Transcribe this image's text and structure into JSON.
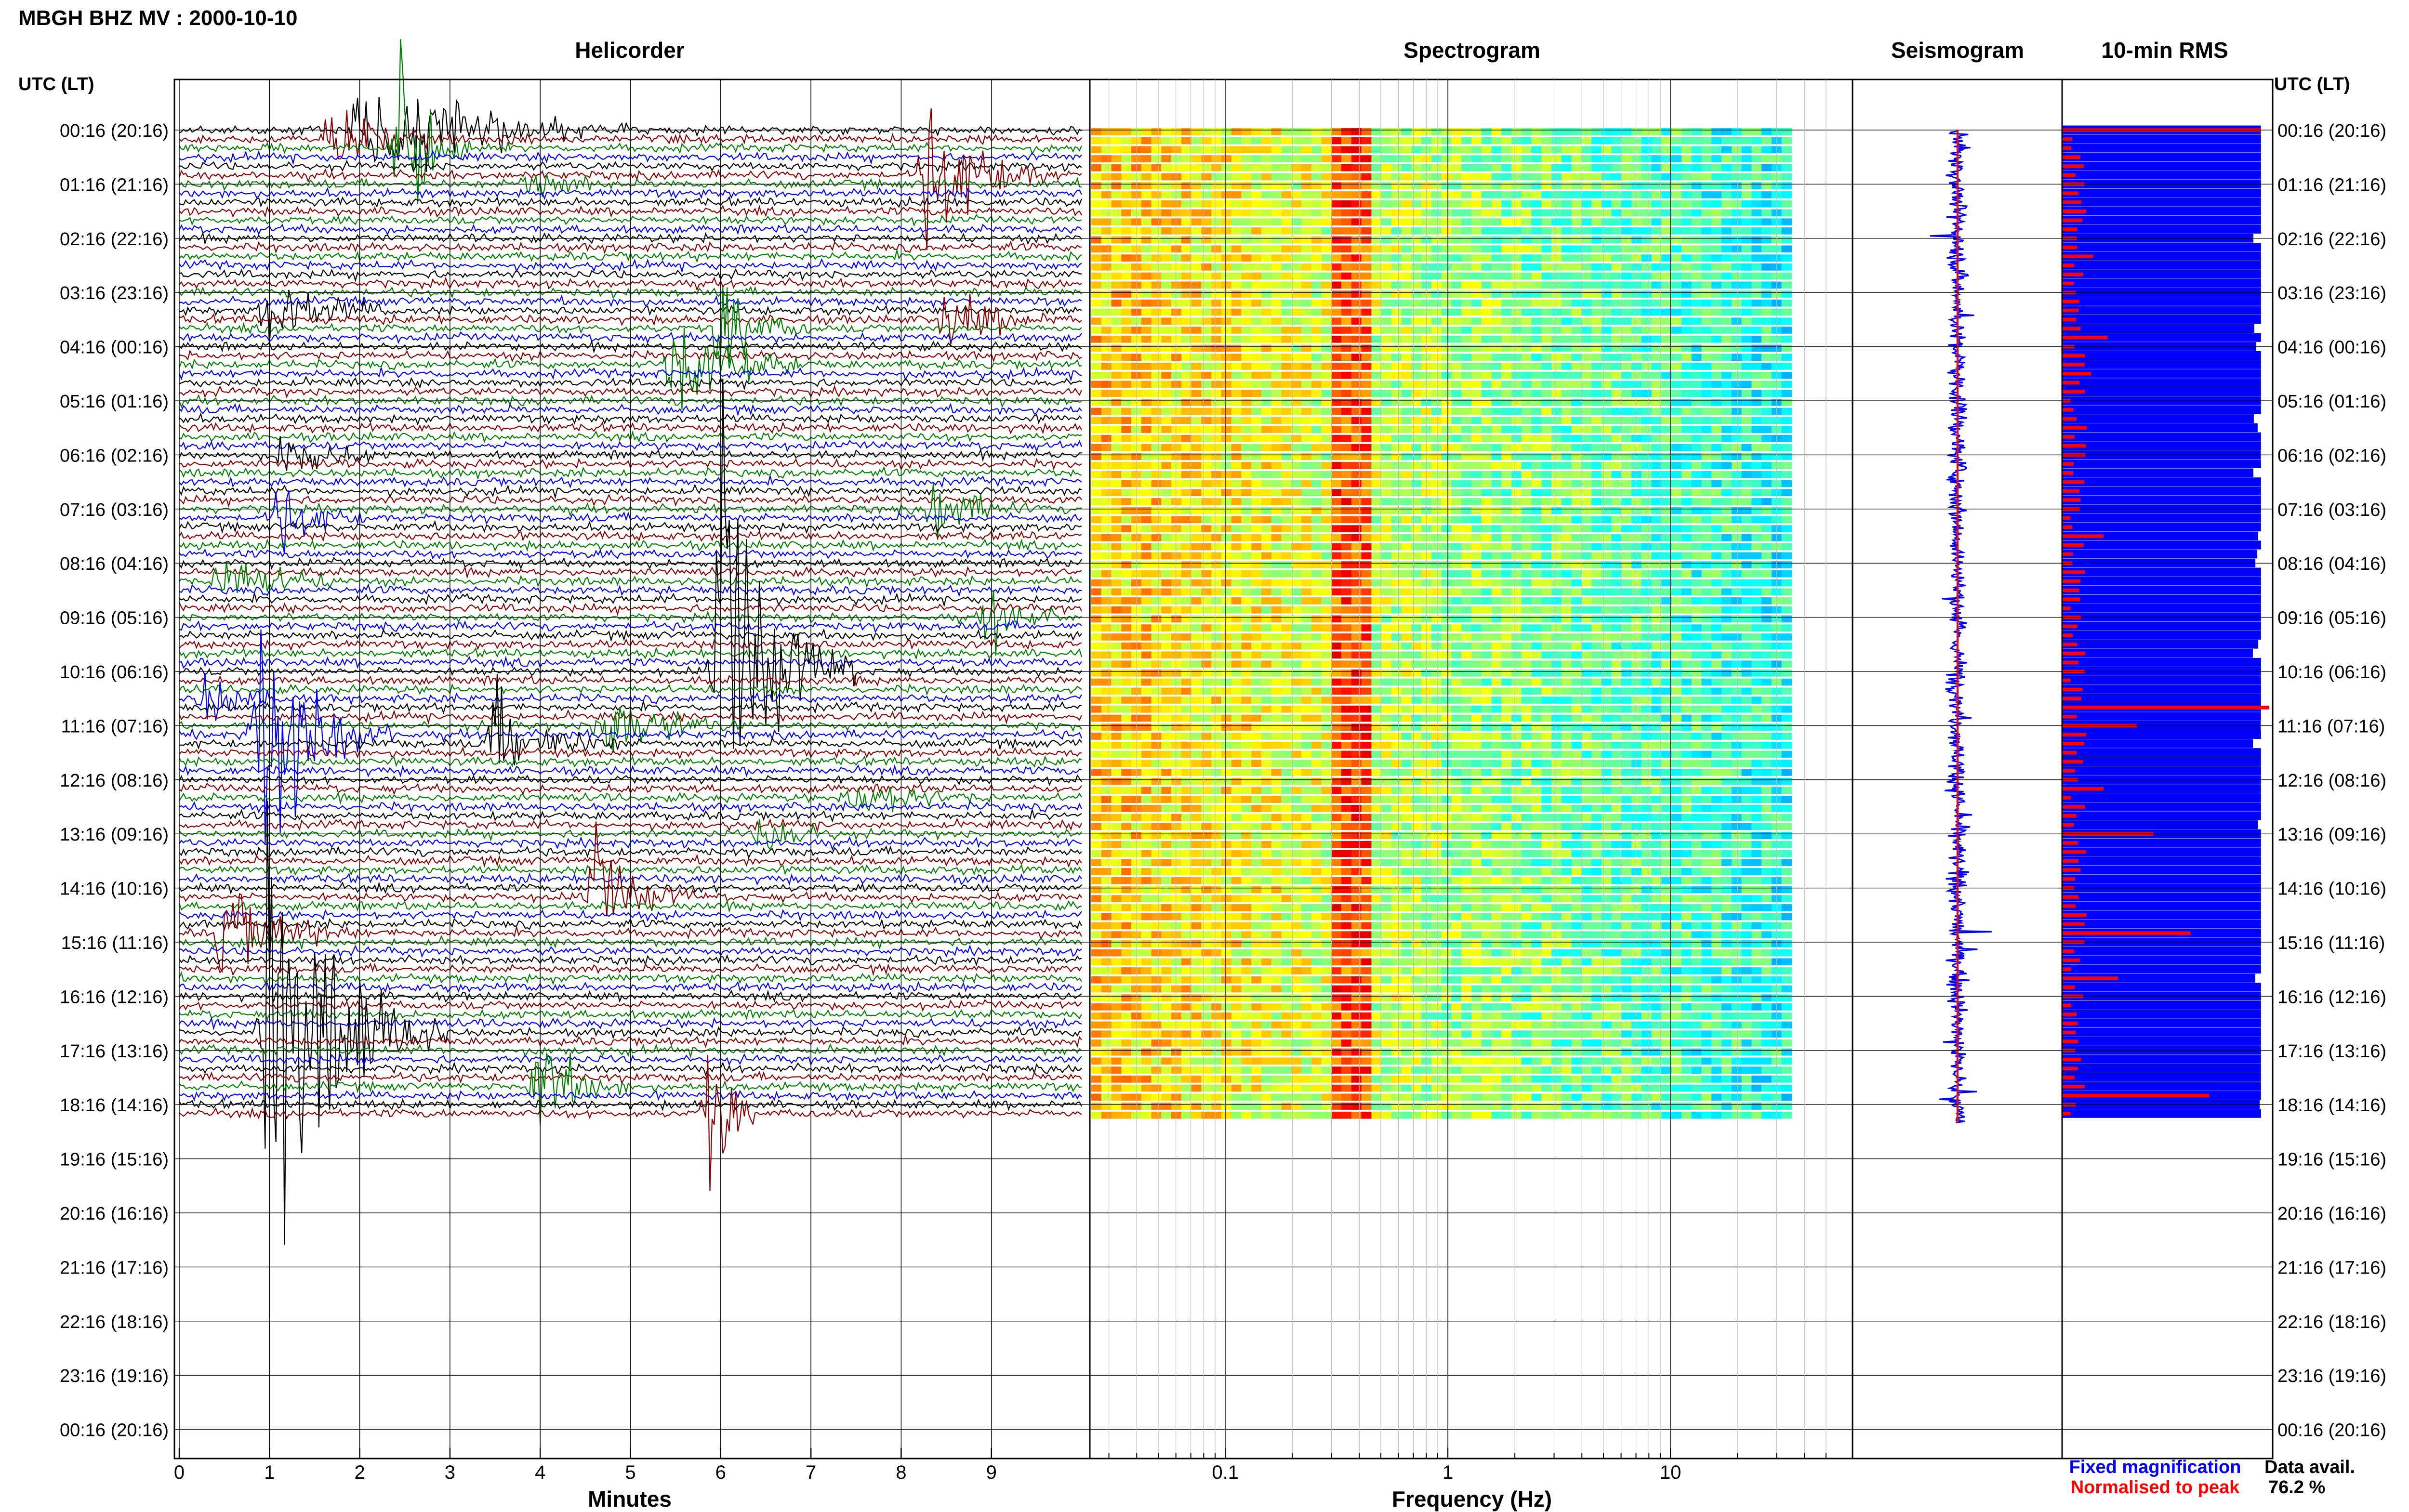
{
  "header": {
    "station_title": "MBGH BHZ MV : 2000-10-10",
    "left_axis_title": "UTC (LT)",
    "right_axis_title": "UTC (LT)"
  },
  "panels": {
    "helicorder": "Helicorder",
    "spectrogram": "Spectrogram",
    "seismogram": "Seismogram",
    "rms": "10-min RMS"
  },
  "legend": {
    "fixed": "Fixed magnification",
    "normalised": "Normalised to peak",
    "fixed_color": "#0000ff",
    "normalised_color": "#ff0000"
  },
  "data_availability": {
    "label": "Data avail.",
    "value": "76.2 %"
  },
  "colors": {
    "trace_cycle": [
      "#000000",
      "#8b0000",
      "#008000",
      "#0000ff"
    ],
    "seismogram": "#0000ff",
    "rms_fixed": "#0000ff",
    "rms_normalised": "#ff0000"
  },
  "chart_data": [
    {
      "type": "line",
      "panel": "Helicorder",
      "xlabel": "Minutes",
      "x_ticks": [
        0,
        1,
        2,
        3,
        4,
        5,
        6,
        7,
        8,
        9
      ],
      "xlim": [
        0,
        10
      ],
      "row_labels": [
        "00:16 (20:16)",
        "01:16 (21:16)",
        "02:16 (22:16)",
        "03:16 (23:16)",
        "04:16 (00:16)",
        "05:16 (01:16)",
        "06:16 (02:16)",
        "07:16 (03:16)",
        "08:16 (04:16)",
        "09:16 (05:16)",
        "10:16 (06:16)",
        "11:16 (07:16)",
        "12:16 (08:16)",
        "13:16 (09:16)",
        "14:16 (10:16)",
        "15:16 (11:16)",
        "16:16 (12:16)",
        "17:16 (13:16)",
        "18:16 (14:16)",
        "19:16 (15:16)",
        "20:16 (16:16)",
        "21:16 (17:16)",
        "22:16 (18:16)",
        "23:16 (19:16)",
        "00:16 (20:16)"
      ],
      "trace_start_hour": 0,
      "trace_end_hour": 18.33,
      "traces_per_hour": 6,
      "events": [
        {
          "row": 0,
          "minute": 2.0,
          "amplitude_rows": 2.5,
          "duration_min": 3.0
        },
        {
          "row": 1,
          "minute": 1.7,
          "amplitude_rows": 1.5,
          "duration_min": 1.5
        },
        {
          "row": 2,
          "minute": 2.45,
          "amplitude_rows": 4.0,
          "duration_min": 0.8
        },
        {
          "row": 5,
          "minute": 8.3,
          "amplitude_rows": 3.0,
          "duration_min": 1.5
        },
        {
          "row": 6,
          "minute": 3.9,
          "amplitude_rows": 0.8,
          "duration_min": 1.0
        },
        {
          "row": 20,
          "minute": 1.0,
          "amplitude_rows": 1.5,
          "duration_min": 1.5
        },
        {
          "row": 21,
          "minute": 8.5,
          "amplitude_rows": 1.3,
          "duration_min": 1.4
        },
        {
          "row": 22,
          "minute": 6.0,
          "amplitude_rows": 2.0,
          "duration_min": 1.0
        },
        {
          "row": 26,
          "minute": 5.5,
          "amplitude_rows": 2.5,
          "duration_min": 1.5
        },
        {
          "row": 36,
          "minute": 1.2,
          "amplitude_rows": 1.5,
          "duration_min": 1.0
        },
        {
          "row": 42,
          "minute": 8.4,
          "amplitude_rows": 1.5,
          "duration_min": 1.0
        },
        {
          "row": 43,
          "minute": 1.1,
          "amplitude_rows": 1.5,
          "duration_min": 1.0
        },
        {
          "row": 50,
          "minute": 0.5,
          "amplitude_rows": 1.2,
          "duration_min": 1.5
        },
        {
          "row": 54,
          "minute": 9.0,
          "amplitude_rows": 1.6,
          "duration_min": 0.8
        },
        {
          "row": 60,
          "minute": 6.0,
          "amplitude_rows": 9.0,
          "duration_min": 1.5
        },
        {
          "row": 63,
          "minute": 0.3,
          "amplitude_rows": 1.2,
          "duration_min": 1.0
        },
        {
          "row": 66,
          "minute": 4.7,
          "amplitude_rows": 2.0,
          "duration_min": 1.5
        },
        {
          "row": 67,
          "minute": 0.9,
          "amplitude_rows": 5.5,
          "duration_min": 1.5
        },
        {
          "row": 68,
          "minute": 3.5,
          "amplitude_rows": 2.0,
          "duration_min": 1.5
        },
        {
          "row": 74,
          "minute": 7.5,
          "amplitude_rows": 1.0,
          "duration_min": 1.5
        },
        {
          "row": 78,
          "minute": 6.5,
          "amplitude_rows": 1.0,
          "duration_min": 1.0
        },
        {
          "row": 85,
          "minute": 4.6,
          "amplitude_rows": 2.2,
          "duration_min": 1.2
        },
        {
          "row": 89,
          "minute": 0.5,
          "amplitude_rows": 2.0,
          "duration_min": 1.5
        },
        {
          "row": 100,
          "minute": 1.0,
          "amplitude_rows": 9.0,
          "duration_min": 2.0
        },
        {
          "row": 106,
          "minute": 4.0,
          "amplitude_rows": 2.2,
          "duration_min": 1.0
        },
        {
          "row": 109,
          "minute": 5.9,
          "amplitude_rows": 4.0,
          "duration_min": 0.5
        }
      ]
    },
    {
      "type": "heatmap",
      "panel": "Spectrogram",
      "xlabel": "Frequency (Hz)",
      "x_scale": "log",
      "x_tick_labels": [
        "0.1",
        "1",
        "10"
      ],
      "xlim": [
        0.025,
        50
      ],
      "data_fmax": 35,
      "peak_band_hz": [
        0.3,
        0.45
      ],
      "colormap": "jet"
    },
    {
      "type": "line",
      "panel": "Seismogram",
      "color": "#0000ff",
      "peak_line_color": "#ff0000"
    },
    {
      "type": "bar",
      "panel": "10-min RMS",
      "orientation": "horizontal",
      "series": [
        {
          "name": "Fixed magnification",
          "color": "#0000ff",
          "typical_level": 0.96
        },
        {
          "name": "Normalised to peak",
          "color": "#ff0000",
          "typical_level": 0.08
        }
      ],
      "highlights": [
        {
          "row": 0,
          "value": 0.96
        },
        {
          "row": 14,
          "value": 0.15
        },
        {
          "row": 23,
          "value": 0.22
        },
        {
          "row": 27,
          "value": 0.14
        },
        {
          "row": 45,
          "value": 0.2
        },
        {
          "row": 49,
          "value": 0.11
        },
        {
          "row": 64,
          "value": 1.0
        },
        {
          "row": 66,
          "value": 0.36
        },
        {
          "row": 73,
          "value": 0.2
        },
        {
          "row": 78,
          "value": 0.44
        },
        {
          "row": 89,
          "value": 0.62
        },
        {
          "row": 94,
          "value": 0.27
        },
        {
          "row": 107,
          "value": 0.71
        }
      ]
    }
  ]
}
